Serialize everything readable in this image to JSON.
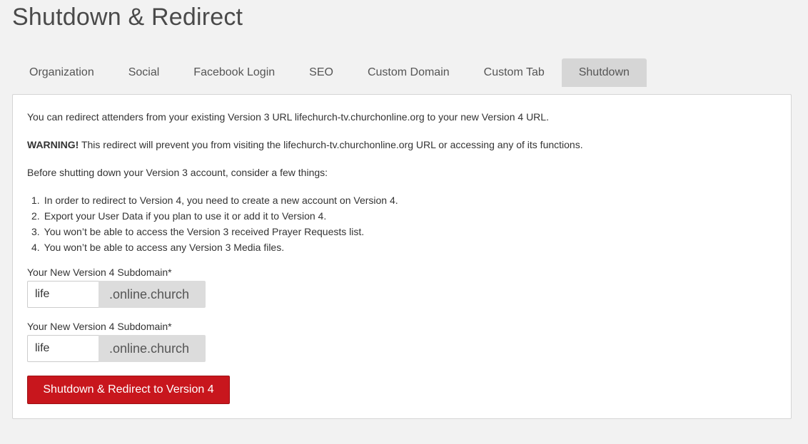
{
  "page": {
    "title": "Shutdown & Redirect"
  },
  "tabs": [
    {
      "label": "Organization"
    },
    {
      "label": "Social"
    },
    {
      "label": "Facebook Login"
    },
    {
      "label": "SEO"
    },
    {
      "label": "Custom Domain"
    },
    {
      "label": "Custom Tab"
    },
    {
      "label": "Shutdown",
      "active": true
    }
  ],
  "panel": {
    "intro": "You can redirect attenders from your existing Version 3 URL lifechurch-tv.churchonline.org to your new Version 4 URL.",
    "warning_label": "WARNING!",
    "warning_text": " This redirect will prevent you from visiting the lifechurch-tv.churchonline.org URL or accessing any of its functions.",
    "consider": "Before shutting down your Version 3 account, consider a few things:",
    "steps": [
      {
        "num": "1.",
        "text": "In order to redirect to Version 4, you need to create a new account on Version 4."
      },
      {
        "num": "2.",
        "text": "Export your User Data if you plan to use it or add it to Version 4."
      },
      {
        "num": "3.",
        "text": "You won’t be able to access the Version 3 received Prayer Requests list."
      },
      {
        "num": "4.",
        "text": "You won’t be able to access any Version 3 Media files."
      }
    ],
    "fields": [
      {
        "label": "Your New Version 4 Subdomain*",
        "value": "life",
        "addon": ".online.church"
      },
      {
        "label": "Your New Version 4 Subdomain*",
        "value": "life",
        "addon": ".online.church"
      }
    ],
    "submit_label": "Shutdown & Redirect to Version 4"
  },
  "colors": {
    "accent": "#c8161d",
    "active_tab": "#d6d6d6",
    "background": "#f2f2f2"
  }
}
